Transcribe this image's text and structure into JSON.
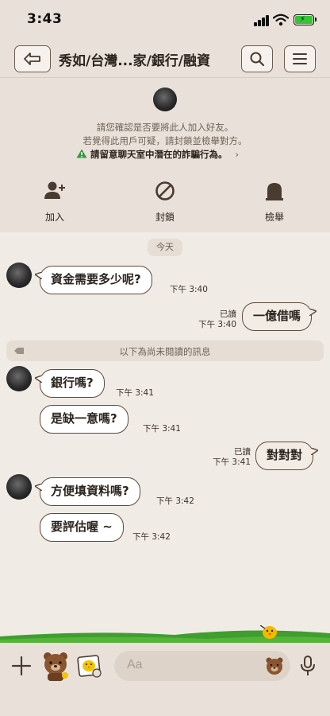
{
  "status_bar": {
    "time": "3:43"
  },
  "nav": {
    "title": "秀如/台灣...家/銀行/融資"
  },
  "notice": {
    "line1": "請您確認是否要將此人加入好友。",
    "line2": "若覺得此用戶可疑，請封鎖並檢舉對方。",
    "warning": "請留意聊天室中潛在的詐騙行為。",
    "actions": [
      {
        "label": "加入",
        "icon": "add-friend-icon"
      },
      {
        "label": "封鎖",
        "icon": "block-icon"
      },
      {
        "label": "檢舉",
        "icon": "report-icon"
      }
    ]
  },
  "chat": {
    "date": "今天",
    "unread_divider": "以下為尚未閱讀的訊息",
    "messages": [
      {
        "dir": "in",
        "text": "資金需要多少呢?",
        "time": "下午 3:40"
      },
      {
        "dir": "out",
        "text": "一億借嗎",
        "read": "已讀",
        "time": "下午 3:40"
      },
      {
        "dir": "in",
        "text": "銀行嗎?",
        "time": "下午 3:41"
      },
      {
        "dir": "in",
        "text": "是缺一意嗎?",
        "time": "下午 3:41"
      },
      {
        "dir": "out",
        "text": "對對對",
        "read": "已讀",
        "time": "下午 3:41"
      },
      {
        "dir": "in",
        "text": "方便填資料嗎?",
        "time": "下午 3:42"
      },
      {
        "dir": "in",
        "text": "要評估喔 ~",
        "time": "下午 3:42"
      }
    ]
  },
  "input": {
    "placeholder": "Aa"
  },
  "colors": {
    "background": "#f0ebe5",
    "header": "#e9e1d9",
    "bubble_border": "#5d4a3d",
    "warning_green": "#2e9b3e",
    "grass": "#3f9e2f"
  }
}
